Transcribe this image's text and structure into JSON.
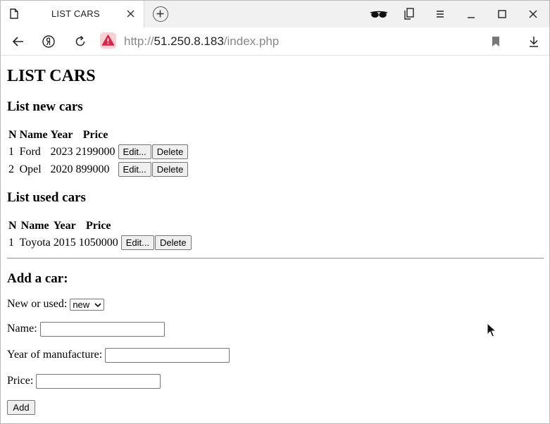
{
  "browser": {
    "tab": {
      "title": "LIST CARS",
      "icon": "document-icon"
    },
    "url": {
      "scheme": "http://",
      "host": "51.250.8.183",
      "path": "/index.php"
    }
  },
  "page": {
    "title": "LIST CARS",
    "new_cars": {
      "heading": "List new cars",
      "columns": [
        "N",
        "Name",
        "Year",
        "Price"
      ],
      "rows": [
        {
          "n": "1",
          "name": "Ford",
          "year": "2023",
          "price": "2199000",
          "edit": "Edit...",
          "delete": "Delete"
        },
        {
          "n": "2",
          "name": "Opel",
          "year": "2020",
          "price": "899000",
          "edit": "Edit...",
          "delete": "Delete"
        }
      ]
    },
    "used_cars": {
      "heading": "List used cars",
      "columns": [
        "N",
        "Name",
        "Year",
        "Price"
      ],
      "rows": [
        {
          "n": "1",
          "name": "Toyota",
          "year": "2015",
          "price": "1050000",
          "edit": "Edit...",
          "delete": "Delete"
        }
      ]
    },
    "form": {
      "heading": "Add a car:",
      "type_label": "New or used:",
      "type_value": "new",
      "name_label": "Name:",
      "name_value": "",
      "year_label": "Year of manufacture:",
      "year_value": "",
      "price_label": "Price:",
      "price_value": "",
      "submit": "Add"
    }
  },
  "colors": {
    "tabstrip_bg": "#f1f1f1",
    "security_badge_bg": "#f7d1d6",
    "security_badge_icon": "#d6294a",
    "button_bg": "#efefef"
  }
}
